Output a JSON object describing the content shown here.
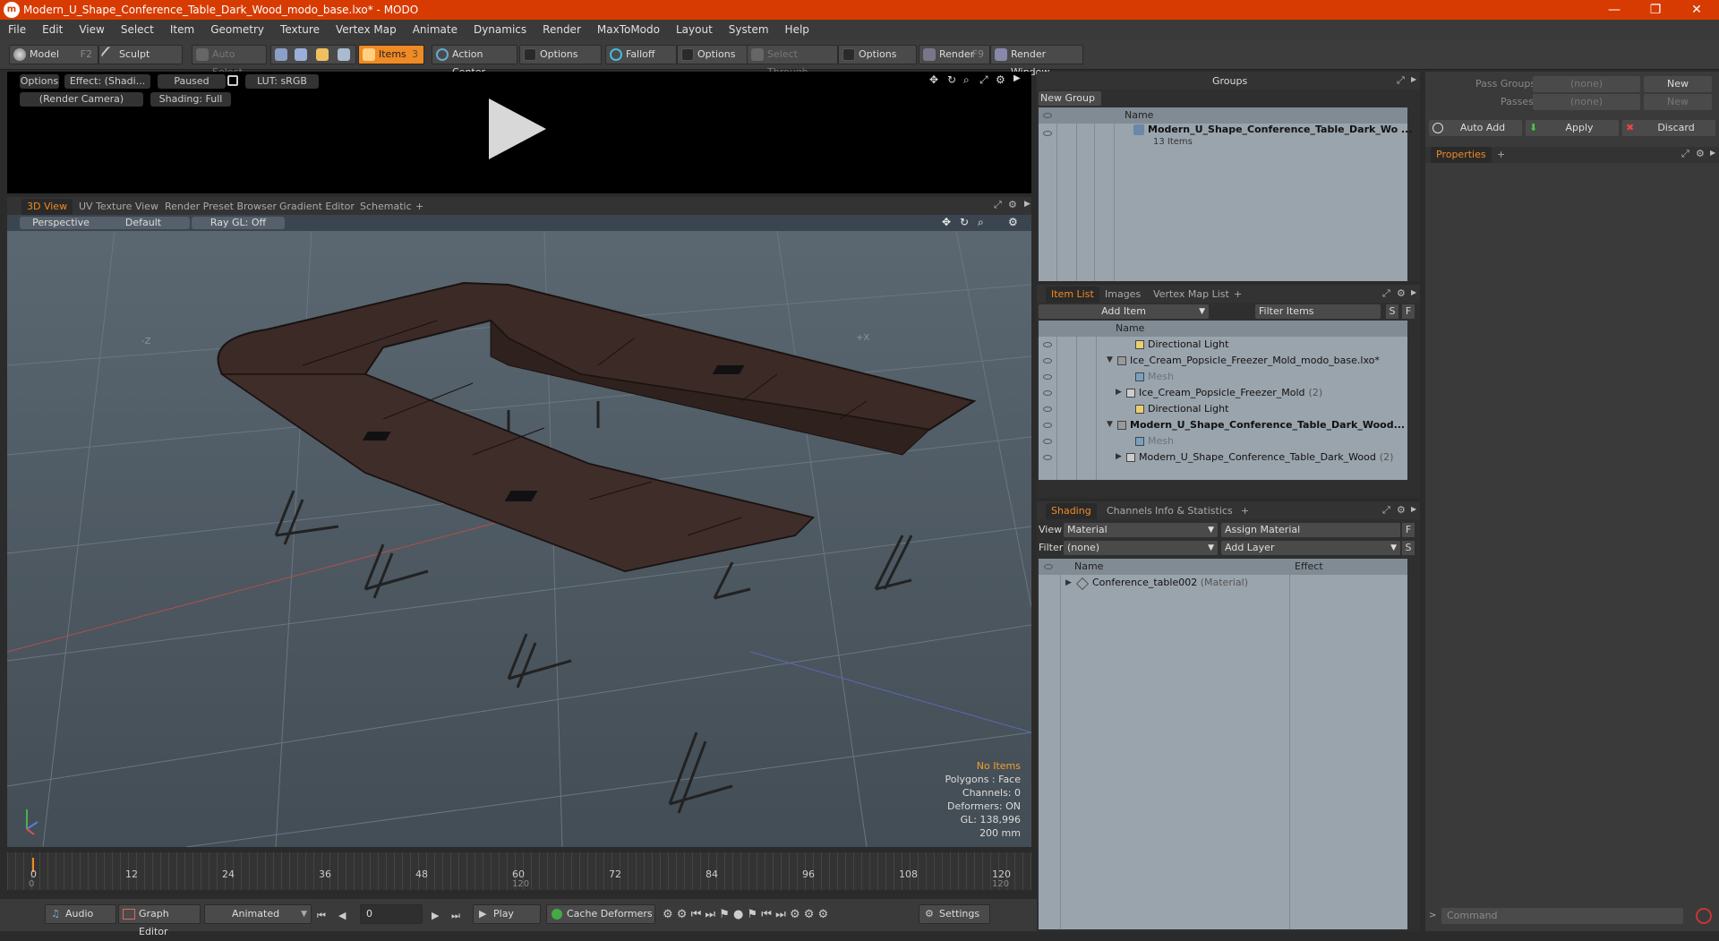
{
  "window": {
    "title": "Modern_U_Shape_Conference_Table_Dark_Wood_modo_base.lxo* - MODO",
    "minimize": "—",
    "maximize": "❐",
    "close": "✕"
  },
  "menu": [
    "File",
    "Edit",
    "View",
    "Select",
    "Item",
    "Geometry",
    "Texture",
    "Vertex Map",
    "Animate",
    "Dynamics",
    "Render",
    "MaxToModo",
    "Layout",
    "System",
    "Help"
  ],
  "toolbar": {
    "model": "Model",
    "model_key": "F2",
    "sculpt": "Sculpt",
    "auto_select": "Auto Select",
    "items": "Items",
    "items_key": "3",
    "action_center": "Action Center",
    "options1": "Options",
    "falloff": "Falloff",
    "options2": "Options",
    "select_through": "Select Through",
    "options3": "Options",
    "render": "Render",
    "render_key": "F9",
    "render_window": "Render Window"
  },
  "preview": {
    "options": "Options",
    "effect": "Effect: (Shadi...",
    "paused": "Paused",
    "lut": "LUT: sRGB",
    "camera": "(Render Camera)",
    "shading": "Shading: Full"
  },
  "viewport_tabs": [
    "3D View",
    "UV Texture View",
    "Render Preset Browser",
    "Gradient Editor",
    "Schematic",
    "+"
  ],
  "viewport": {
    "perspective": "Perspective",
    "default": "Default",
    "raygl": "Ray GL: Off",
    "axis_minus_z": "-Z",
    "axis_plus_x": "+X",
    "info": {
      "no_items": "No Items",
      "polygons": "Polygons : Face",
      "channels": "Channels: 0",
      "deformers": "Deformers: ON",
      "gl": "GL: 138,996",
      "scale": "200 mm"
    }
  },
  "timeline": {
    "ticks": [
      "0",
      "12",
      "24",
      "36",
      "48",
      "60",
      "72",
      "84",
      "96",
      "108",
      "120"
    ],
    "start": "0",
    "mid": "120",
    "end": "120"
  },
  "bottombar": {
    "audio": "Audio",
    "graph_editor": "Graph Editor",
    "animated": "Animated",
    "frame": "0",
    "play": "Play",
    "cache_deformers": "Cache Deformers",
    "settings": "Settings"
  },
  "groups": {
    "title": "Groups",
    "new_group": "New Group",
    "col_name": "Name",
    "item_name": "Modern_U_Shape_Conference_Table_Dark_Wo ...",
    "item_count": "13 Items"
  },
  "item_list": {
    "tabs": [
      "Item List",
      "Images",
      "Vertex Map List",
      "+"
    ],
    "add_item": "Add Item",
    "filter": "Filter Items",
    "s": "S",
    "f": "F",
    "col_name": "Name",
    "rows": [
      {
        "label": "Directional Light",
        "indent": 3,
        "type": "light",
        "bold": false,
        "dim": false
      },
      {
        "label": "Ice_Cream_Popsicle_Freezer_Mold_modo_base.lxo*",
        "indent": 1,
        "type": "scene",
        "bold": false,
        "dim": false
      },
      {
        "label": "Mesh",
        "indent": 3,
        "type": "mesh",
        "bold": false,
        "dim": true
      },
      {
        "label": "Ice_Cream_Popsicle_Freezer_Mold",
        "count": "(2)",
        "indent": 2,
        "type": "group",
        "bold": false,
        "dim": false
      },
      {
        "label": "Directional Light",
        "indent": 3,
        "type": "light",
        "bold": false,
        "dim": false
      },
      {
        "label": "Modern_U_Shape_Conference_Table_Dark_Wood...",
        "indent": 1,
        "type": "scene",
        "bold": true,
        "dim": false
      },
      {
        "label": "Mesh",
        "indent": 3,
        "type": "mesh",
        "bold": false,
        "dim": true
      },
      {
        "label": "Modern_U_Shape_Conference_Table_Dark_Wood",
        "count": "(2)",
        "indent": 2,
        "type": "group",
        "bold": false,
        "dim": false
      }
    ]
  },
  "shading": {
    "tabs": [
      "Shading",
      "Channels",
      "Info & Statistics",
      "+"
    ],
    "view_label": "View",
    "view_value": "Material",
    "assign_material": "Assign Material",
    "filter_label": "Filter",
    "filter_value": "(none)",
    "add_layer": "Add Layer",
    "f": "F",
    "s": "S",
    "col_name": "Name",
    "col_effect": "Effect",
    "material": "Conference_table002",
    "material_type": "(Material)"
  },
  "right": {
    "pass_groups": "Pass Groups",
    "passes": "Passes",
    "none1": "(none)",
    "none2": "(none)",
    "new1": "New",
    "new2": "New",
    "auto_add": "Auto Add",
    "apply": "Apply",
    "discard": "Discard",
    "properties_tab": "Properties",
    "plus": "+",
    "command": "Command"
  },
  "colors": {
    "title_bar": "#d83b01",
    "accent": "#f08a24",
    "wood": "#3b2a26"
  }
}
